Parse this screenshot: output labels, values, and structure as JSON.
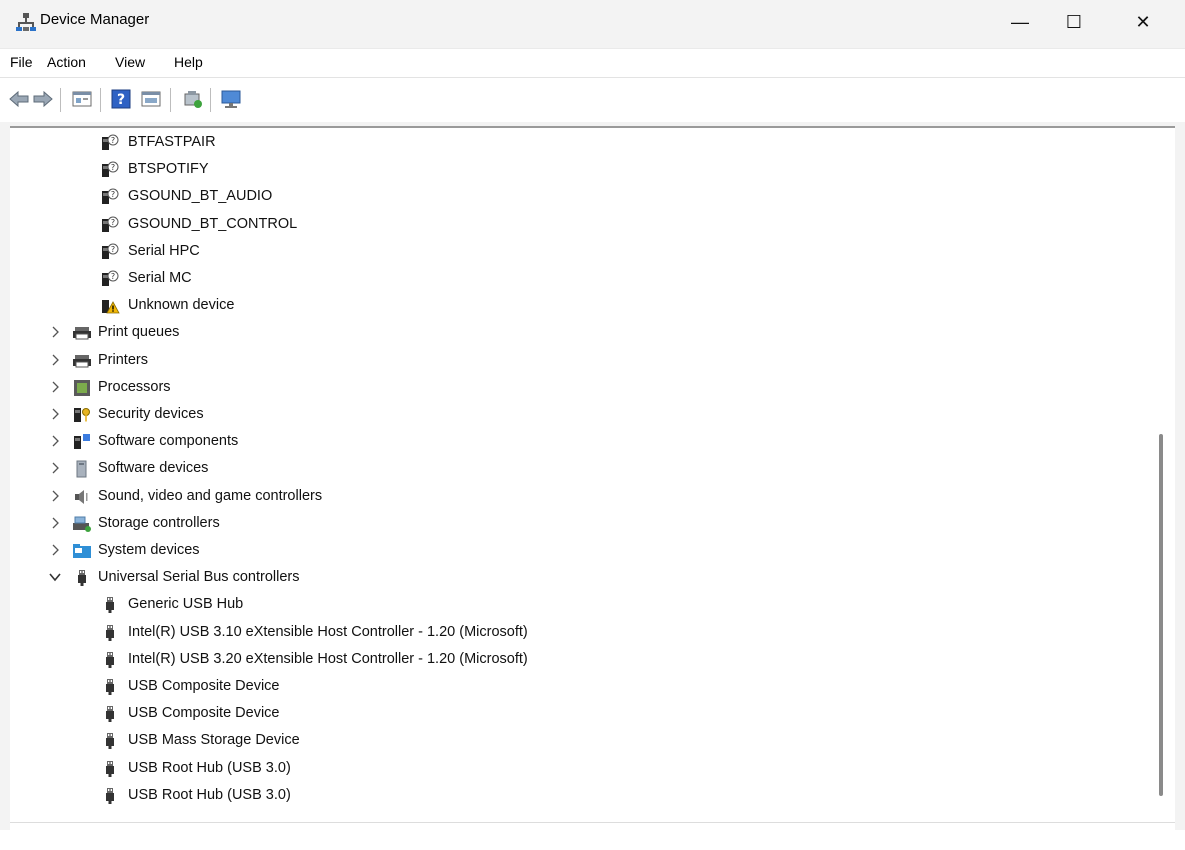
{
  "window": {
    "title": "Device Manager",
    "minimize": "—",
    "maximize": "☐",
    "close": "✕"
  },
  "menu": [
    "File",
    "Action",
    "View",
    "Help"
  ],
  "tree": [
    {
      "label": "BTFASTPAIR",
      "level": 2,
      "icon": "bt-device-unknown-icon"
    },
    {
      "label": "BTSPOTIFY",
      "level": 2,
      "icon": "bt-device-unknown-icon"
    },
    {
      "label": "GSOUND_BT_AUDIO",
      "level": 2,
      "icon": "bt-device-unknown-icon"
    },
    {
      "label": "GSOUND_BT_CONTROL",
      "level": 2,
      "icon": "bt-device-unknown-icon"
    },
    {
      "label": "Serial HPC",
      "level": 2,
      "icon": "bt-device-unknown-icon"
    },
    {
      "label": "Serial MC",
      "level": 2,
      "icon": "bt-device-unknown-icon"
    },
    {
      "label": "Unknown device",
      "level": 2,
      "icon": "warning-device-icon"
    },
    {
      "label": "Print queues",
      "level": 1,
      "expander": "collapsed",
      "icon": "printer-icon"
    },
    {
      "label": "Printers",
      "level": 1,
      "expander": "collapsed",
      "icon": "printer-icon"
    },
    {
      "label": "Processors",
      "level": 1,
      "expander": "collapsed",
      "icon": "processor-icon"
    },
    {
      "label": "Security devices",
      "level": 1,
      "expander": "collapsed",
      "icon": "security-key-icon"
    },
    {
      "label": "Software components",
      "level": 1,
      "expander": "collapsed",
      "icon": "software-component-icon"
    },
    {
      "label": "Software devices",
      "level": 1,
      "expander": "collapsed",
      "icon": "software-device-icon"
    },
    {
      "label": "Sound, video and game controllers",
      "level": 1,
      "expander": "collapsed",
      "icon": "speaker-icon"
    },
    {
      "label": "Storage controllers",
      "level": 1,
      "expander": "collapsed",
      "icon": "storage-controller-icon"
    },
    {
      "label": "System devices",
      "level": 1,
      "expander": "collapsed",
      "icon": "system-folder-icon"
    },
    {
      "label": "Universal Serial Bus controllers",
      "level": 1,
      "expander": "expanded",
      "icon": "usb-plug-icon"
    },
    {
      "label": "Generic USB Hub",
      "level": 2,
      "icon": "usb-plug-icon"
    },
    {
      "label": "Intel(R) USB 3.10 eXtensible Host Controller - 1.20 (Microsoft)",
      "level": 2,
      "icon": "usb-plug-icon"
    },
    {
      "label": "Intel(R) USB 3.20 eXtensible Host Controller - 1.20 (Microsoft)",
      "level": 2,
      "icon": "usb-plug-icon"
    },
    {
      "label": "USB Composite Device",
      "level": 2,
      "icon": "usb-plug-icon"
    },
    {
      "label": "USB Composite Device",
      "level": 2,
      "icon": "usb-plug-icon"
    },
    {
      "label": "USB Mass Storage Device",
      "level": 2,
      "icon": "usb-plug-icon"
    },
    {
      "label": "USB Root Hub (USB 3.0)",
      "level": 2,
      "icon": "usb-plug-icon"
    },
    {
      "label": "USB Root Hub (USB 3.0)",
      "level": 2,
      "icon": "usb-plug-icon"
    }
  ],
  "colors": {
    "accent": "#1a5fb4",
    "warning": "#f2b705"
  }
}
